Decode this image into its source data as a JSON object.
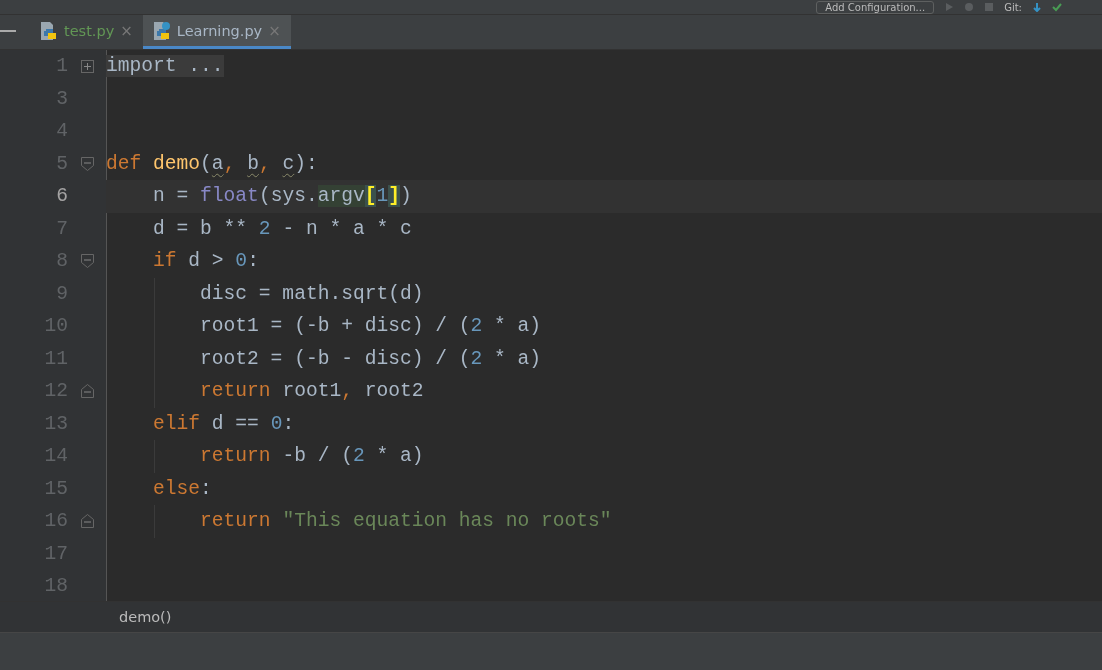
{
  "toolbar": {
    "config_button": "Add Configuration...",
    "vcs_label": "Git:"
  },
  "tabs": [
    {
      "label": "test.py",
      "selected": false,
      "color": "#629755",
      "close": "×"
    },
    {
      "label": "Learning.py",
      "selected": true,
      "color": "#a9b7c6",
      "close": "×"
    }
  ],
  "editor": {
    "lines": [
      {
        "number": "1",
        "kind": "fold-collapsed",
        "current": false,
        "tokens": [
          {
            "text": "import ...",
            "kind": "folded"
          }
        ]
      },
      {
        "number": "3",
        "kind": "plain",
        "current": false
      },
      {
        "number": "4",
        "kind": "plain",
        "current": false
      },
      {
        "number": "5",
        "kind": "fold-open",
        "current": false,
        "tokens": [
          {
            "text": "def ",
            "kind": "kw"
          },
          {
            "text": "demo",
            "kind": "fn"
          },
          {
            "text": "(",
            "kind": "plain"
          },
          {
            "text": "a",
            "kind": "param"
          },
          {
            "text": ", ",
            "kind": "punct"
          },
          {
            "text": "b",
            "kind": "param"
          },
          {
            "text": ", ",
            "kind": "punct"
          },
          {
            "text": "c",
            "kind": "param"
          },
          {
            "text": "):",
            "kind": "plain"
          }
        ]
      },
      {
        "number": "6",
        "kind": "plain",
        "current": true,
        "tokens": [
          {
            "text": "    n = ",
            "kind": "plain"
          },
          {
            "text": "float",
            "kind": "builtin"
          },
          {
            "text": "(sys.",
            "kind": "plain"
          },
          {
            "text": "argv",
            "kind": "highlight"
          },
          {
            "text": "[",
            "kind": "match"
          },
          {
            "text": "1",
            "kind": "num"
          },
          {
            "text": "]",
            "kind": "match"
          },
          {
            "text": ")",
            "kind": "plain"
          }
        ]
      },
      {
        "number": "7",
        "kind": "plain",
        "current": false,
        "tokens": [
          {
            "text": "    d = b ** ",
            "kind": "plain"
          },
          {
            "text": "2",
            "kind": "num"
          },
          {
            "text": " - n * a * c",
            "kind": "plain"
          }
        ]
      },
      {
        "number": "8",
        "kind": "fold-open",
        "current": false,
        "tokens": [
          {
            "text": "    if",
            "kind": "kw"
          },
          {
            "text": " d > ",
            "kind": "plain"
          },
          {
            "text": "0",
            "kind": "num"
          },
          {
            "text": ":",
            "kind": "plain"
          }
        ]
      },
      {
        "number": "9",
        "kind": "plain",
        "current": false,
        "tokens": [
          {
            "text": "        disc = math.sqrt(d)",
            "kind": "plain"
          }
        ]
      },
      {
        "number": "10",
        "kind": "plain",
        "current": false,
        "tokens": [
          {
            "text": "        root1 = (-b + disc) / (",
            "kind": "plain"
          },
          {
            "text": "2",
            "kind": "num"
          },
          {
            "text": " * a)",
            "kind": "plain"
          }
        ]
      },
      {
        "number": "11",
        "kind": "plain",
        "current": false,
        "tokens": [
          {
            "text": "        root2 = (-b - disc) / (",
            "kind": "plain"
          },
          {
            "text": "2",
            "kind": "num"
          },
          {
            "text": " * a)",
            "kind": "plain"
          }
        ]
      },
      {
        "number": "12",
        "kind": "fold-end",
        "current": false,
        "tokens": [
          {
            "text": "        return",
            "kind": "kw"
          },
          {
            "text": " root1",
            "kind": "plain"
          },
          {
            "text": ", ",
            "kind": "punct"
          },
          {
            "text": "root2",
            "kind": "plain"
          }
        ]
      },
      {
        "number": "13",
        "kind": "plain",
        "current": false,
        "tokens": [
          {
            "text": "    elif",
            "kind": "kw"
          },
          {
            "text": " d == ",
            "kind": "plain"
          },
          {
            "text": "0",
            "kind": "num"
          },
          {
            "text": ":",
            "kind": "plain"
          }
        ]
      },
      {
        "number": "14",
        "kind": "plain",
        "current": false,
        "tokens": [
          {
            "text": "        return",
            "kind": "kw"
          },
          {
            "text": " -b / (",
            "kind": "plain"
          },
          {
            "text": "2",
            "kind": "num"
          },
          {
            "text": " * a)",
            "kind": "plain"
          }
        ]
      },
      {
        "number": "15",
        "kind": "plain",
        "current": false,
        "tokens": [
          {
            "text": "    else",
            "kind": "kw"
          },
          {
            "text": ":",
            "kind": "plain"
          }
        ]
      },
      {
        "number": "16",
        "kind": "fold-end",
        "current": false,
        "tokens": [
          {
            "text": "        return",
            "kind": "kw"
          },
          {
            "text": " \"This equation has no roots\"",
            "kind": "str"
          }
        ]
      },
      {
        "number": "17",
        "kind": "plain",
        "current": false
      },
      {
        "number": "18",
        "kind": "plain",
        "current": false
      }
    ]
  },
  "breadcrumb": "demo()"
}
